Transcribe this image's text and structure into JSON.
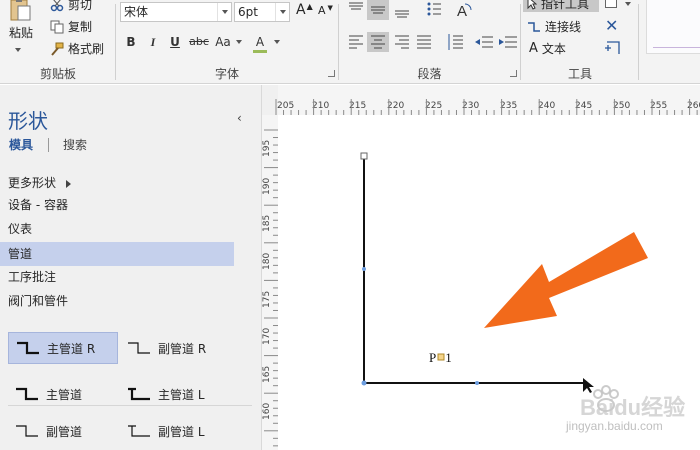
{
  "ribbon": {
    "clipboard": {
      "paste": "粘贴",
      "cut": "剪切",
      "copy": "复制",
      "format_painter": "格式刷",
      "group_label": "剪贴板"
    },
    "font": {
      "family": "宋体",
      "size": "6pt",
      "bold": "B",
      "italic": "I",
      "underline": "U",
      "strikethrough": "abc",
      "change_case": "Aa",
      "font_color": "A",
      "grow": "A",
      "shrink": "A",
      "group_label": "字体"
    },
    "paragraph": {
      "group_label": "段落"
    },
    "tools": {
      "pointer_tool": "指针工具",
      "connector": "连接线",
      "text": "文本",
      "group_label": "工具"
    }
  },
  "shapes_pane": {
    "title": "形状",
    "tab_stencils": "模具",
    "tab_search": "搜索",
    "stencils": [
      {
        "label": "更多形状",
        "active": false
      },
      {
        "label": "设备 - 容器",
        "active": false
      },
      {
        "label": "仪表",
        "active": false
      },
      {
        "label": "管道",
        "active": true
      },
      {
        "label": "工序批注",
        "active": false
      },
      {
        "label": "阀门和管件",
        "active": false
      }
    ],
    "masters": [
      {
        "label": "主管道 R",
        "selected": true
      },
      {
        "label": "副管道 R",
        "selected": false
      },
      {
        "label": "主管道",
        "selected": false
      },
      {
        "label": "主管道 L",
        "selected": false
      },
      {
        "label": "副管道",
        "selected": false
      },
      {
        "label": "副管道 L",
        "selected": false
      }
    ]
  },
  "ruler": {
    "h_labels": [
      "205",
      "210",
      "215",
      "220",
      "225",
      "230",
      "235",
      "240",
      "245",
      "250",
      "255",
      "260"
    ],
    "v_labels": [
      "195",
      "190",
      "185",
      "180",
      "175",
      "170",
      "165",
      "160"
    ]
  },
  "canvas": {
    "shape_label": "P",
    "shape_label_suffix": "1"
  },
  "watermark": {
    "brand": "Baidu经验",
    "url": "jingyan.baidu.com"
  },
  "colors": {
    "accent": "#2b579a",
    "selection": "#c5d0ec",
    "arrow": "#f26a1b",
    "ribbon_bg": "#f3f3f3",
    "pane_bg": "#f0f0f0"
  }
}
